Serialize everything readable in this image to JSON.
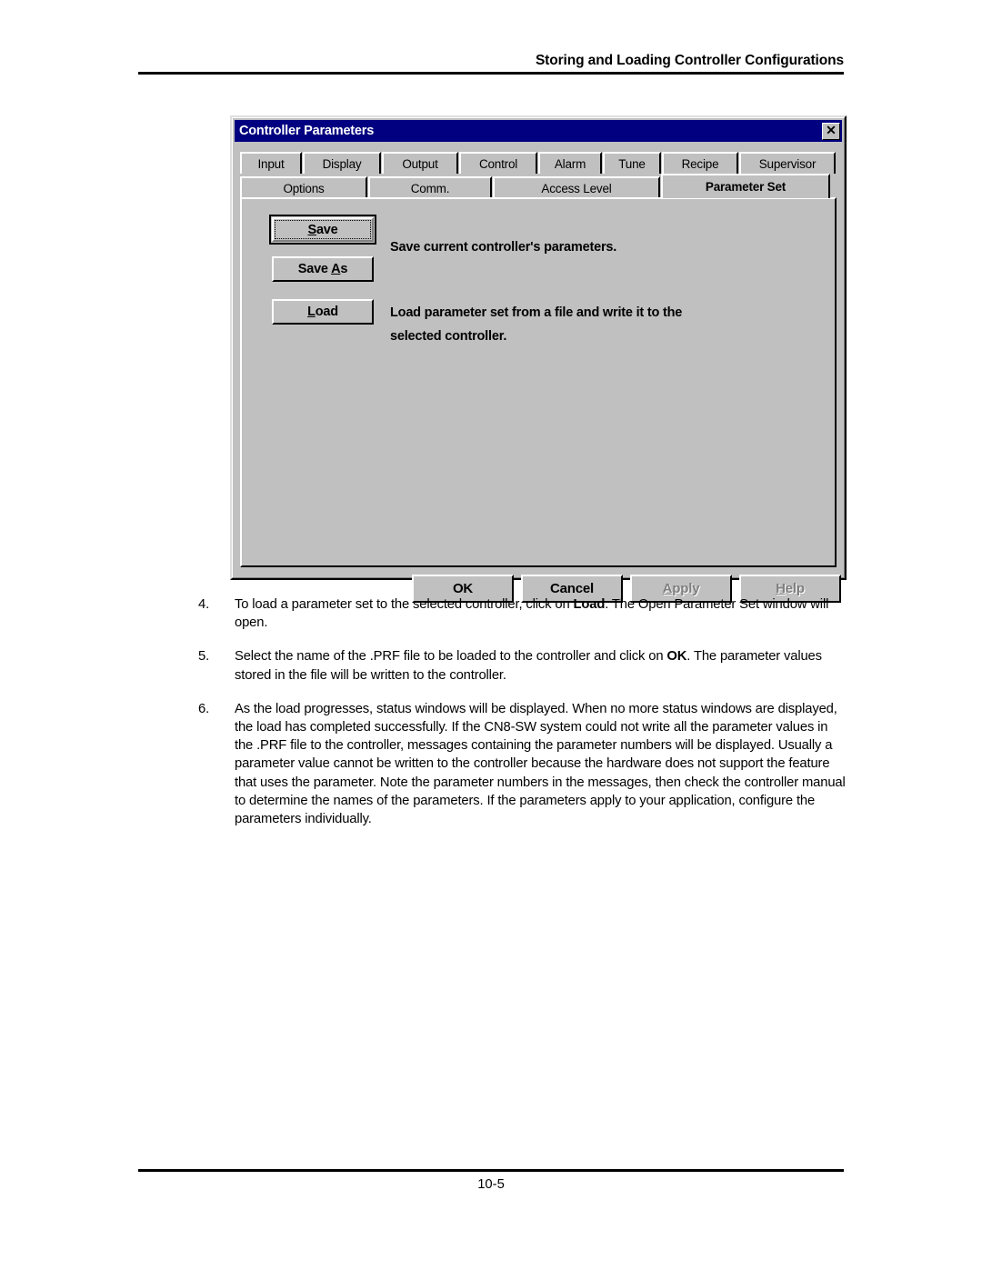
{
  "page": {
    "header_title": "Storing and Loading Controller Configurations",
    "page_number": "10-5"
  },
  "dialog": {
    "title": "Controller Parameters",
    "close_icon": "close-x-icon",
    "tabs_row1": [
      {
        "label": "Input"
      },
      {
        "label": "Display"
      },
      {
        "label": "Output"
      },
      {
        "label": "Control"
      },
      {
        "label": "Alarm"
      },
      {
        "label": "Tune"
      },
      {
        "label": "Recipe"
      },
      {
        "label": "Supervisor"
      }
    ],
    "tabs_row2": [
      {
        "label": "Options"
      },
      {
        "label": "Comm."
      },
      {
        "label": "Access Level"
      },
      {
        "label": "Parameter Set",
        "active": true
      }
    ],
    "panel": {
      "buttons": [
        {
          "label": "Save",
          "mnemonic": "S",
          "default": true
        },
        {
          "label": "Save As",
          "mnemonic": "A"
        },
        {
          "label": "Load",
          "mnemonic": "L"
        }
      ],
      "descriptions": [
        "Save current controller's parameters.",
        "Load parameter set from a file and write it to the",
        "selected controller."
      ]
    },
    "footer_buttons": [
      {
        "label": "OK",
        "disabled": false
      },
      {
        "label": "Cancel",
        "disabled": false
      },
      {
        "label": "Apply",
        "mnemonic": "A",
        "disabled": true
      },
      {
        "label": "Help",
        "mnemonic": "H",
        "disabled": true
      }
    ]
  },
  "body": {
    "paragraphs": [
      {
        "number": "4.",
        "text": "To load a parameter set to the selected controller, click on Load.  The Open Parameter Set window will open."
      },
      {
        "number": "5.",
        "text": "Select the name of the .PRF file to be loaded to the controller and click on OK.  The parameter values stored in the file will be written to the controller."
      },
      {
        "number": "6.",
        "text": "As the load progresses, status windows will be displayed.  When no more status windows are displayed, the load has completed successfully.  If the CN8-SW system could not write all the parameter values in the .PRF file to the controller, messages containing the parameter numbers will be displayed.  Usually a parameter value cannot be written to the controller because the hardware does not support the feature that uses the parameter.  Note the parameter numbers in the messages, then check the controller manual to determine the names of the parameters.  If the parameters apply to your application, configure the parameters individually."
      }
    ]
  },
  "colors": {
    "titlebar": "#000080",
    "dialog_face": "#c0c0c0",
    "text": "#000000",
    "disabled_text": "#808080"
  }
}
